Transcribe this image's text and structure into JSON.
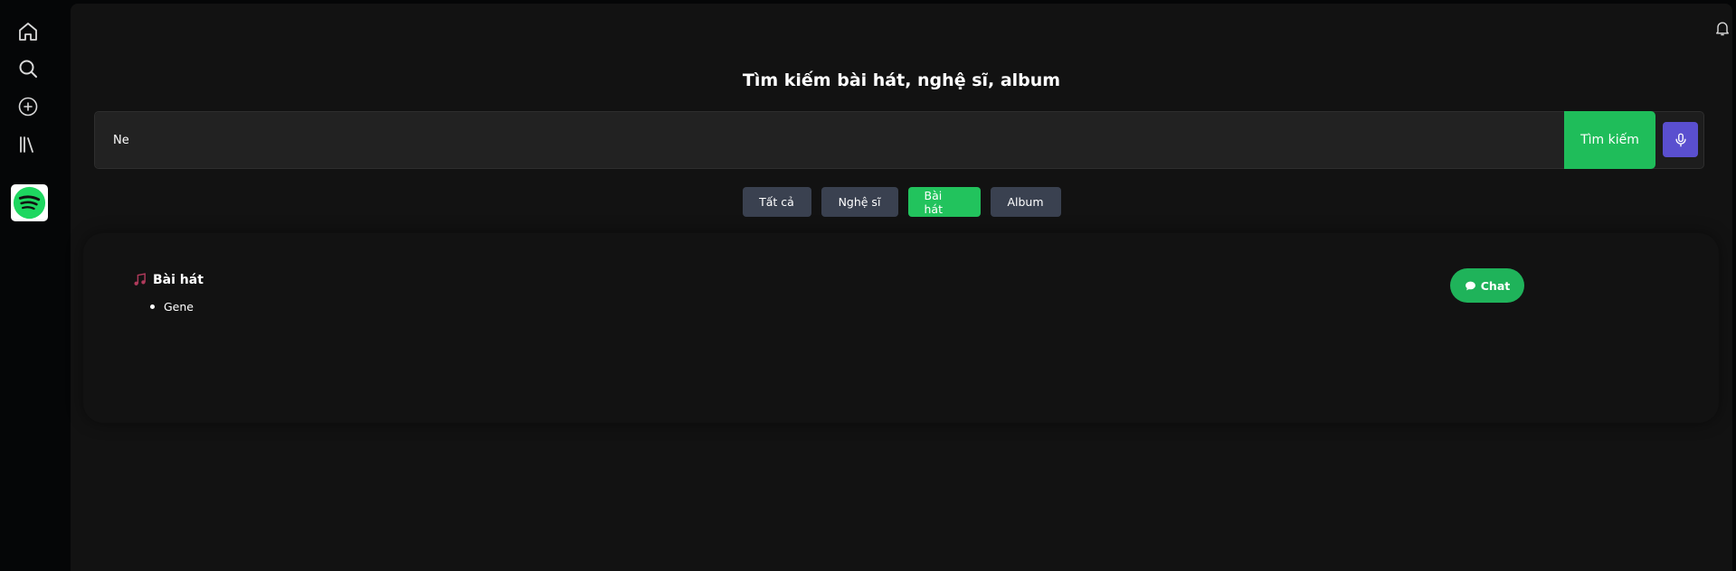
{
  "sidebar": {
    "icons": [
      "home-icon",
      "search-icon",
      "add-circle-icon",
      "library-icon",
      "spotify-logo"
    ]
  },
  "header": {
    "bell_icon": "bell-icon",
    "avatar_icon": "python-logo"
  },
  "search": {
    "title": "Tìm kiếm bài hát, nghệ sĩ, album",
    "value": "Ne",
    "button_label": "Tìm kiếm",
    "mic_icon": "microphone-icon"
  },
  "filters": [
    {
      "label": "Tất cả",
      "active": false
    },
    {
      "label": "Nghệ sĩ",
      "active": false
    },
    {
      "label": "Bài hát",
      "active": true
    },
    {
      "label": "Album",
      "active": false
    }
  ],
  "results": {
    "heading": "Bài hát",
    "heading_icon": "music-note-icon",
    "items": [
      "Gene"
    ]
  },
  "chat": {
    "label": "Chat",
    "icon": "chat-bubble-icon"
  },
  "colors": {
    "background": "#121212",
    "accent_green": "#1fbd5a",
    "mic_purple": "#5a4fcf",
    "filter_default": "#3a4150"
  }
}
